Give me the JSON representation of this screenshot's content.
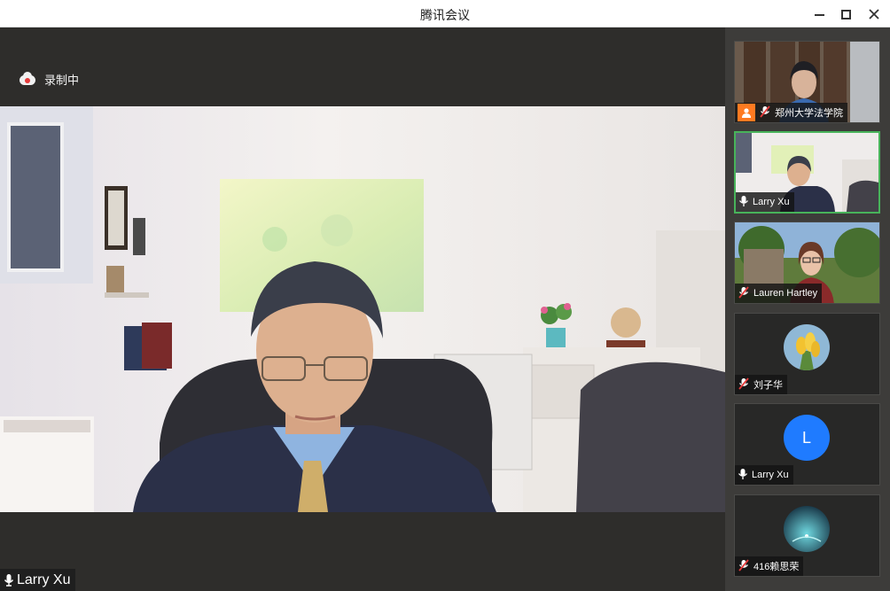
{
  "window": {
    "title": "腾讯会议"
  },
  "recording": {
    "label": "录制中"
  },
  "main_video": {
    "speaker_name": "Larry Xu"
  },
  "participants": [
    {
      "name": "郑州大学法学院",
      "mic": "muted",
      "host": true,
      "type": "video"
    },
    {
      "name": "Larry Xu",
      "mic": "on",
      "type": "video",
      "active_speaker": true
    },
    {
      "name": "Lauren Hartley",
      "mic": "muted",
      "type": "video"
    },
    {
      "name": "刘子华",
      "mic": "muted",
      "type": "avatar-image"
    },
    {
      "name": "Larry Xu",
      "mic": "on",
      "type": "avatar-letter",
      "avatar_letter": "L"
    },
    {
      "name": "416赖思荣",
      "mic": "muted",
      "type": "avatar-image"
    }
  ],
  "colors": {
    "active_border": "#48b35a",
    "host_badge": "#ff7a21",
    "muted_slash": "#e53b3b",
    "avatar_blue": "#1f7bff"
  }
}
